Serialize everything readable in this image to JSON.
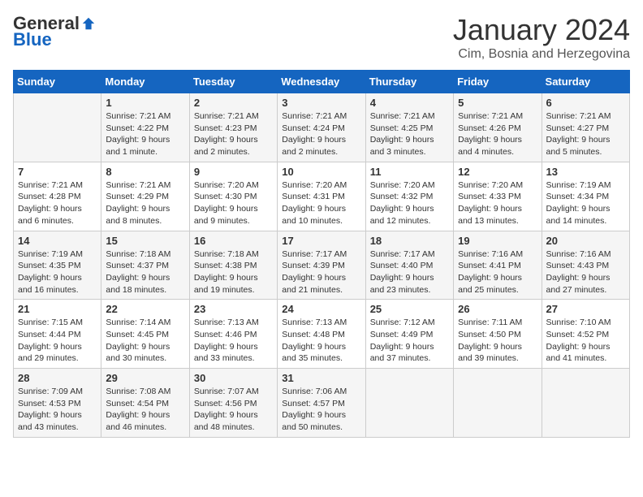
{
  "logo": {
    "general": "General",
    "blue": "Blue"
  },
  "title": "January 2024",
  "location": "Cim, Bosnia and Herzegovina",
  "days_of_week": [
    "Sunday",
    "Monday",
    "Tuesday",
    "Wednesday",
    "Thursday",
    "Friday",
    "Saturday"
  ],
  "weeks": [
    [
      {
        "day": "",
        "info": ""
      },
      {
        "day": "1",
        "info": "Sunrise: 7:21 AM\nSunset: 4:22 PM\nDaylight: 9 hours\nand 1 minute."
      },
      {
        "day": "2",
        "info": "Sunrise: 7:21 AM\nSunset: 4:23 PM\nDaylight: 9 hours\nand 2 minutes."
      },
      {
        "day": "3",
        "info": "Sunrise: 7:21 AM\nSunset: 4:24 PM\nDaylight: 9 hours\nand 2 minutes."
      },
      {
        "day": "4",
        "info": "Sunrise: 7:21 AM\nSunset: 4:25 PM\nDaylight: 9 hours\nand 3 minutes."
      },
      {
        "day": "5",
        "info": "Sunrise: 7:21 AM\nSunset: 4:26 PM\nDaylight: 9 hours\nand 4 minutes."
      },
      {
        "day": "6",
        "info": "Sunrise: 7:21 AM\nSunset: 4:27 PM\nDaylight: 9 hours\nand 5 minutes."
      }
    ],
    [
      {
        "day": "7",
        "info": "Sunrise: 7:21 AM\nSunset: 4:28 PM\nDaylight: 9 hours\nand 6 minutes."
      },
      {
        "day": "8",
        "info": "Sunrise: 7:21 AM\nSunset: 4:29 PM\nDaylight: 9 hours\nand 8 minutes."
      },
      {
        "day": "9",
        "info": "Sunrise: 7:20 AM\nSunset: 4:30 PM\nDaylight: 9 hours\nand 9 minutes."
      },
      {
        "day": "10",
        "info": "Sunrise: 7:20 AM\nSunset: 4:31 PM\nDaylight: 9 hours\nand 10 minutes."
      },
      {
        "day": "11",
        "info": "Sunrise: 7:20 AM\nSunset: 4:32 PM\nDaylight: 9 hours\nand 12 minutes."
      },
      {
        "day": "12",
        "info": "Sunrise: 7:20 AM\nSunset: 4:33 PM\nDaylight: 9 hours\nand 13 minutes."
      },
      {
        "day": "13",
        "info": "Sunrise: 7:19 AM\nSunset: 4:34 PM\nDaylight: 9 hours\nand 14 minutes."
      }
    ],
    [
      {
        "day": "14",
        "info": "Sunrise: 7:19 AM\nSunset: 4:35 PM\nDaylight: 9 hours\nand 16 minutes."
      },
      {
        "day": "15",
        "info": "Sunrise: 7:18 AM\nSunset: 4:37 PM\nDaylight: 9 hours\nand 18 minutes."
      },
      {
        "day": "16",
        "info": "Sunrise: 7:18 AM\nSunset: 4:38 PM\nDaylight: 9 hours\nand 19 minutes."
      },
      {
        "day": "17",
        "info": "Sunrise: 7:17 AM\nSunset: 4:39 PM\nDaylight: 9 hours\nand 21 minutes."
      },
      {
        "day": "18",
        "info": "Sunrise: 7:17 AM\nSunset: 4:40 PM\nDaylight: 9 hours\nand 23 minutes."
      },
      {
        "day": "19",
        "info": "Sunrise: 7:16 AM\nSunset: 4:41 PM\nDaylight: 9 hours\nand 25 minutes."
      },
      {
        "day": "20",
        "info": "Sunrise: 7:16 AM\nSunset: 4:43 PM\nDaylight: 9 hours\nand 27 minutes."
      }
    ],
    [
      {
        "day": "21",
        "info": "Sunrise: 7:15 AM\nSunset: 4:44 PM\nDaylight: 9 hours\nand 29 minutes."
      },
      {
        "day": "22",
        "info": "Sunrise: 7:14 AM\nSunset: 4:45 PM\nDaylight: 9 hours\nand 30 minutes."
      },
      {
        "day": "23",
        "info": "Sunrise: 7:13 AM\nSunset: 4:46 PM\nDaylight: 9 hours\nand 33 minutes."
      },
      {
        "day": "24",
        "info": "Sunrise: 7:13 AM\nSunset: 4:48 PM\nDaylight: 9 hours\nand 35 minutes."
      },
      {
        "day": "25",
        "info": "Sunrise: 7:12 AM\nSunset: 4:49 PM\nDaylight: 9 hours\nand 37 minutes."
      },
      {
        "day": "26",
        "info": "Sunrise: 7:11 AM\nSunset: 4:50 PM\nDaylight: 9 hours\nand 39 minutes."
      },
      {
        "day": "27",
        "info": "Sunrise: 7:10 AM\nSunset: 4:52 PM\nDaylight: 9 hours\nand 41 minutes."
      }
    ],
    [
      {
        "day": "28",
        "info": "Sunrise: 7:09 AM\nSunset: 4:53 PM\nDaylight: 9 hours\nand 43 minutes."
      },
      {
        "day": "29",
        "info": "Sunrise: 7:08 AM\nSunset: 4:54 PM\nDaylight: 9 hours\nand 46 minutes."
      },
      {
        "day": "30",
        "info": "Sunrise: 7:07 AM\nSunset: 4:56 PM\nDaylight: 9 hours\nand 48 minutes."
      },
      {
        "day": "31",
        "info": "Sunrise: 7:06 AM\nSunset: 4:57 PM\nDaylight: 9 hours\nand 50 minutes."
      },
      {
        "day": "",
        "info": ""
      },
      {
        "day": "",
        "info": ""
      },
      {
        "day": "",
        "info": ""
      }
    ]
  ]
}
